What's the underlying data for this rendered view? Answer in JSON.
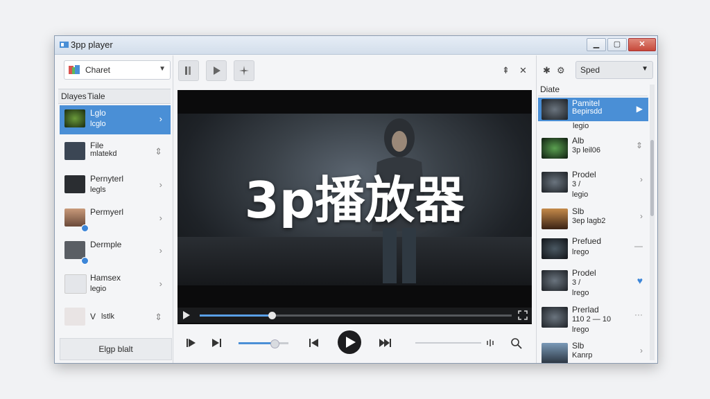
{
  "window": {
    "title": "3pp player"
  },
  "channel_select": {
    "label": "Charet"
  },
  "left_panel": {
    "columns": [
      "Dlayes",
      "Tiale"
    ],
    "items": [
      {
        "name": "Lglo",
        "sub": "lcglo",
        "active": true
      },
      {
        "name": "File",
        "sub": "mlatekd",
        "active": false
      },
      {
        "name": "Pernyterl",
        "sub": "legls",
        "active": false
      },
      {
        "name": "Permyerl",
        "sub": "",
        "active": false
      },
      {
        "name": "Dermple",
        "sub": "",
        "active": false
      },
      {
        "name": "Hamsex",
        "sub": "legio",
        "active": false
      },
      {
        "name": "V",
        "sub": "lstlk",
        "active": false
      }
    ],
    "footer_button": "Elgp blalt"
  },
  "video": {
    "overlay_text": "3p播放器",
    "seek_progress": 0.23
  },
  "volume": {
    "level": 0.72
  },
  "speed_select": {
    "label": "Sped"
  },
  "right_panel": {
    "header": "Diate",
    "items": [
      {
        "name": "Pamitel",
        "sub": "Bepirsdd",
        "sub2": "legio",
        "action": "play",
        "active": true
      },
      {
        "name": "Alb",
        "sub": "3p leil06",
        "sub2": "",
        "action": "sort",
        "active": false
      },
      {
        "name": "Prodel",
        "sub": "3 /",
        "sub2": "legio",
        "action": "chevron",
        "active": false
      },
      {
        "name": "Slb",
        "sub": "3ep lagb2",
        "sub2": "",
        "action": "chevron",
        "active": false
      },
      {
        "name": "Prefued",
        "sub": "lrego",
        "sub2": "",
        "action": "dash",
        "active": false
      },
      {
        "name": "Prodel",
        "sub": "3 /",
        "sub2": "lrego",
        "action": "heart",
        "active": false
      },
      {
        "name": "Prerlad",
        "sub": "110 2 — 10",
        "sub2": "lrego",
        "action": "more",
        "active": false
      },
      {
        "name": "Slb",
        "sub": "Kanrp",
        "sub2": "",
        "action": "chevron",
        "active": false
      }
    ]
  },
  "colors": {
    "accent": "#4a8fd6",
    "close": "#c6493a",
    "video_bg": "#0b0b0c"
  }
}
